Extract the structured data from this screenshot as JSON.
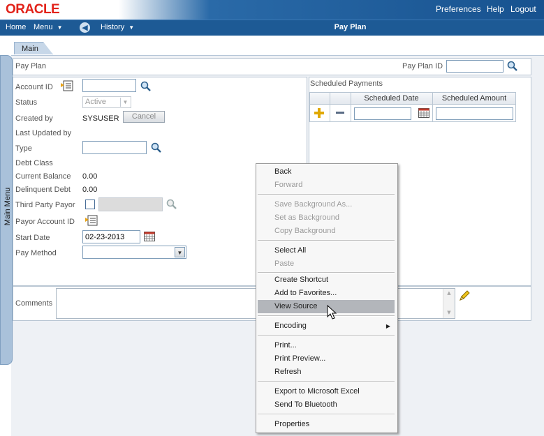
{
  "header": {
    "logo": "ORACLE",
    "links": {
      "preferences": "Preferences",
      "help": "Help",
      "logout": "Logout"
    }
  },
  "nav": {
    "home": "Home",
    "menu": "Menu",
    "history": "History",
    "page_title": "Pay Plan"
  },
  "tabs": {
    "main": "Main"
  },
  "side_menu": {
    "label": "Main Menu"
  },
  "pay_plan": {
    "section_label": "Pay Plan",
    "id_label": "Pay Plan ID",
    "id_value": ""
  },
  "form": {
    "account_id_label": "Account ID",
    "status_label": "Status",
    "status_value": "Active",
    "created_by_label": "Created by",
    "created_by_value": "SYSUSER",
    "cancel_button": "Cancel",
    "last_updated_label": "Last Updated by",
    "type_label": "Type",
    "debt_class_label": "Debt Class",
    "current_balance_label": "Current Balance",
    "current_balance_value": "0.00",
    "delinquent_debt_label": "Delinquent Debt",
    "delinquent_debt_value": "0.00",
    "third_party_payor_label": "Third Party Payor",
    "payor_account_label": "Payor Account ID",
    "start_date_label": "Start Date",
    "start_date_value": "02-23-2013",
    "pay_method_label": "Pay Method"
  },
  "scheduled": {
    "title": "Scheduled Payments",
    "col_date": "Scheduled Date",
    "col_amount": "Scheduled Amount"
  },
  "comments": {
    "label": "Comments"
  },
  "context_menu": {
    "back": "Back",
    "forward": "Forward",
    "save_background": "Save Background As...",
    "set_background": "Set as Background",
    "copy_background": "Copy Background",
    "select_all": "Select All",
    "paste": "Paste",
    "create_shortcut": "Create Shortcut",
    "add_favorites": "Add to Favorites...",
    "view_source": "View Source",
    "encoding": "Encoding",
    "print": "Print...",
    "print_preview": "Print Preview...",
    "refresh": "Refresh",
    "export_excel": "Export to Microsoft Excel",
    "send_bluetooth": "Send To Bluetooth",
    "properties": "Properties"
  },
  "colors": {
    "brand_red": "#e2231a",
    "header_blue": "#1d5a95",
    "menu_highlight": "#b3b6bb"
  }
}
